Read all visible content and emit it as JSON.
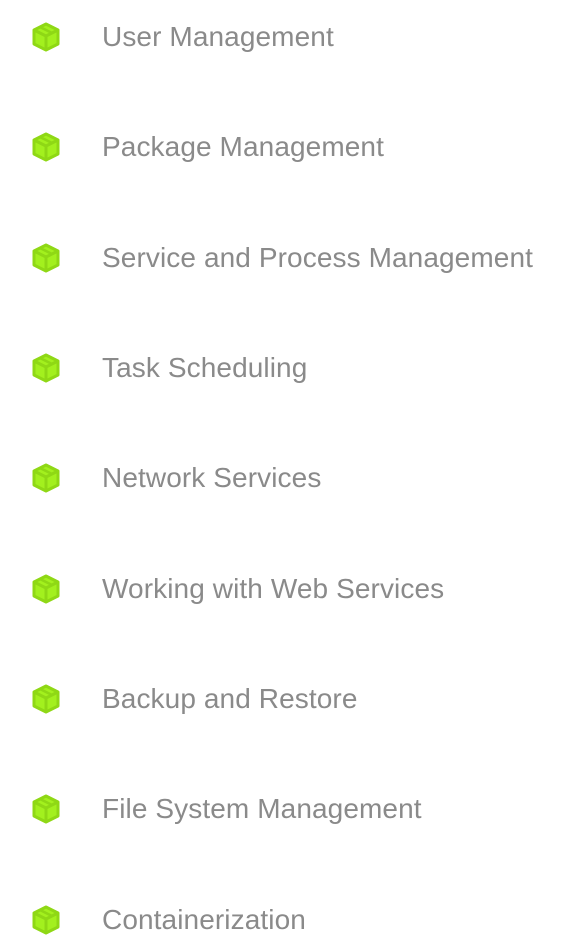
{
  "topics": {
    "icon": "cube-icon",
    "accent_color": "#a3f01e",
    "outline_color": "#8fd815",
    "label_color": "#8a8a8a",
    "items": [
      {
        "label": "User Management"
      },
      {
        "label": "Package Management"
      },
      {
        "label": "Service and Process Management"
      },
      {
        "label": "Task Scheduling"
      },
      {
        "label": "Network Services"
      },
      {
        "label": "Working with Web Services"
      },
      {
        "label": "Backup and Restore"
      },
      {
        "label": "File System Management"
      },
      {
        "label": "Containerization"
      }
    ]
  }
}
